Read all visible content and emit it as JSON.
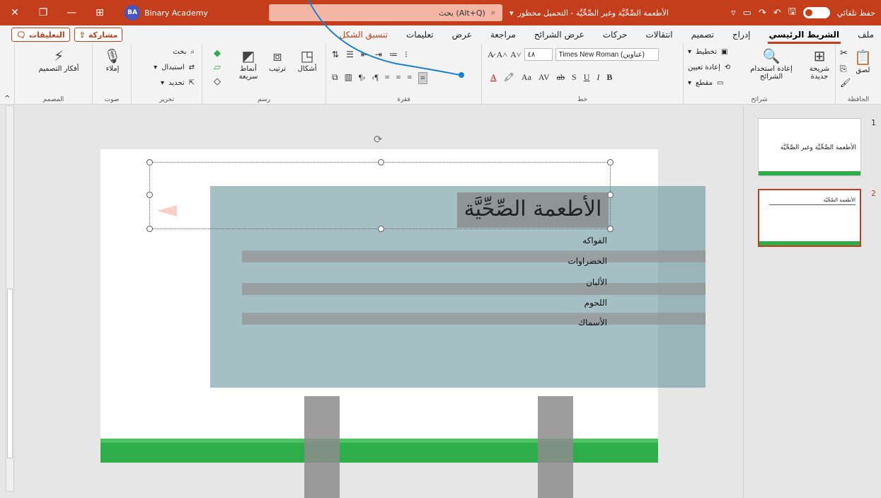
{
  "titlebar": {
    "account_initials": "BA",
    "account_name": "Binary Academy",
    "search_placeholder": "بحث (Alt+Q)",
    "doc_title": "الأطعمة الصِّحِّيَّة وغير الصِّحِّيَّة - التحميل محظور",
    "autosave_label": "حفظ تلقائي",
    "close_icon": "close-icon",
    "accent": "#c43e1c"
  },
  "tabs": [
    {
      "label": "ملف"
    },
    {
      "label": "الشريط الرئيسي"
    },
    {
      "label": "إدراج"
    },
    {
      "label": "تصميم"
    },
    {
      "label": "انتقالات"
    },
    {
      "label": "حركات"
    },
    {
      "label": "عرض الشرائح"
    },
    {
      "label": "مراجعة"
    },
    {
      "label": "عرض"
    },
    {
      "label": "تعليمات"
    },
    {
      "label": "تنسيق الشكل"
    }
  ],
  "share": {
    "comments_label": "التعليقات",
    "share_label": "مشاركة"
  },
  "ribbon": {
    "clipboard": {
      "label": "الحافظة",
      "paste": "لصق"
    },
    "slides": {
      "label": "شرائح",
      "new_slide": "شريحة جديدة",
      "reuse": "إعادة استخدام الشرائح",
      "layout": "تخطيط",
      "reset": "إعادة تعيين",
      "section": "مقطع"
    },
    "font": {
      "label": "خط",
      "font_name": "Times New Roman (عناوين)",
      "font_size": "٤٨"
    },
    "paragraph": {
      "label": "فقرة"
    },
    "drawing": {
      "label": "رسم",
      "shapes": "أشكال",
      "arrange": "ترتيب",
      "quick_styles": "أنماط سريعة"
    },
    "editing": {
      "label": "تحرير",
      "find": "بحث",
      "replace": "استبدال",
      "select": "تحديد"
    },
    "voice": {
      "label": "صوت",
      "dictate": "إملاء"
    },
    "designer": {
      "label": "المصمم",
      "ideas": "أفكار التصميم"
    }
  },
  "slides": [
    {
      "number": "1",
      "title": "الأطعمة الصِّحِّيَّة وغير الصِّحِّيَّة"
    },
    {
      "number": "2",
      "title": "الأطعمة الصِّحِّيَّة"
    }
  ],
  "current_slide": {
    "title": "الأطعمة الصِّحِّيَّة",
    "bullets": [
      "الفواكه",
      "الخضراوات",
      "الألبان",
      "اللحوم",
      "الأسماك"
    ]
  }
}
